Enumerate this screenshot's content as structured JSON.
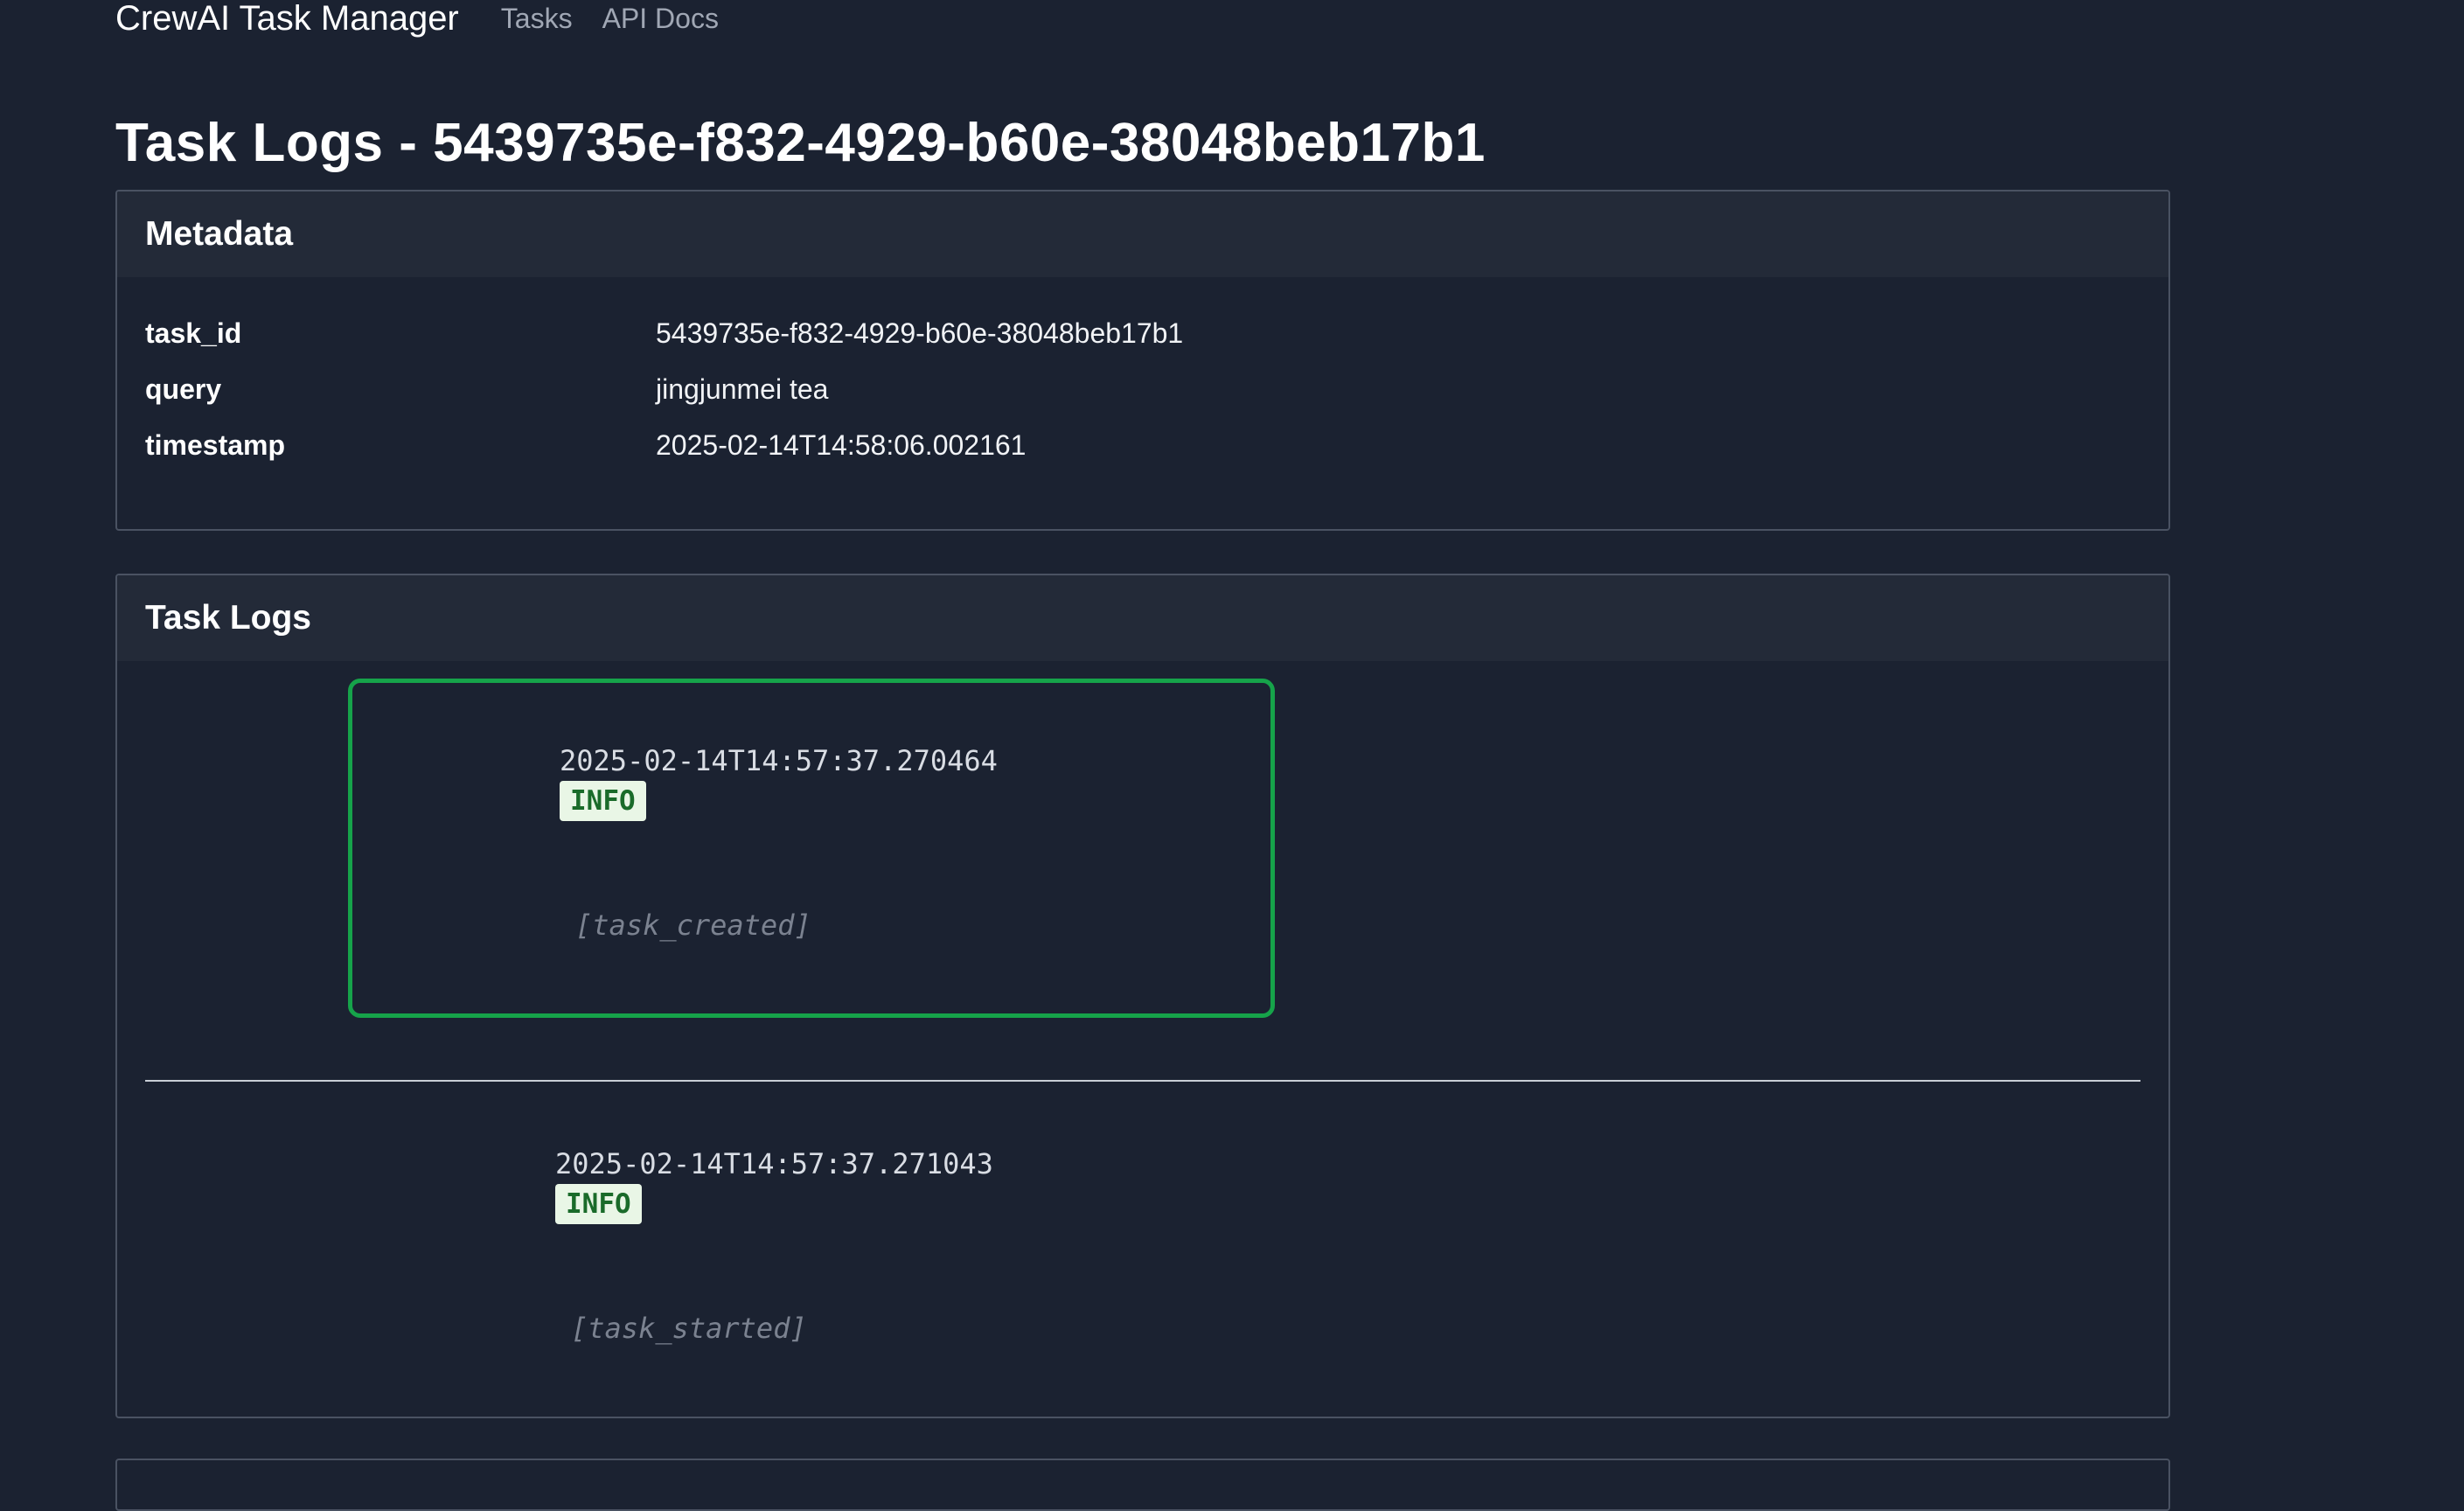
{
  "nav": {
    "brand": "CrewAI Task Manager",
    "links": [
      "Tasks",
      "API Docs"
    ]
  },
  "page": {
    "title": "Task Logs - 5439735e-f832-4929-b60e-38048beb17b1"
  },
  "metadata": {
    "header": "Metadata",
    "rows": [
      {
        "key": "task_id",
        "value": "5439735e-f832-4929-b60e-38048beb17b1"
      },
      {
        "key": "query",
        "value": "jingjunmei tea"
      },
      {
        "key": "timestamp",
        "value": "2025-02-14T14:58:06.002161"
      }
    ]
  },
  "logs": {
    "header": "Task Logs",
    "entries": [
      {
        "timestamp": "2025-02-14T14:57:37.270464",
        "level": "INFO",
        "event": "[task_created]"
      },
      {
        "timestamp": "2025-02-14T14:57:37.271043",
        "level": "INFO",
        "event": "[task_started]"
      }
    ]
  },
  "colors": {
    "background": "#1b2231",
    "selection_border": "#16a34a",
    "info_badge_bg": "#e9f6e6",
    "info_badge_text": "#1a6b2a"
  }
}
